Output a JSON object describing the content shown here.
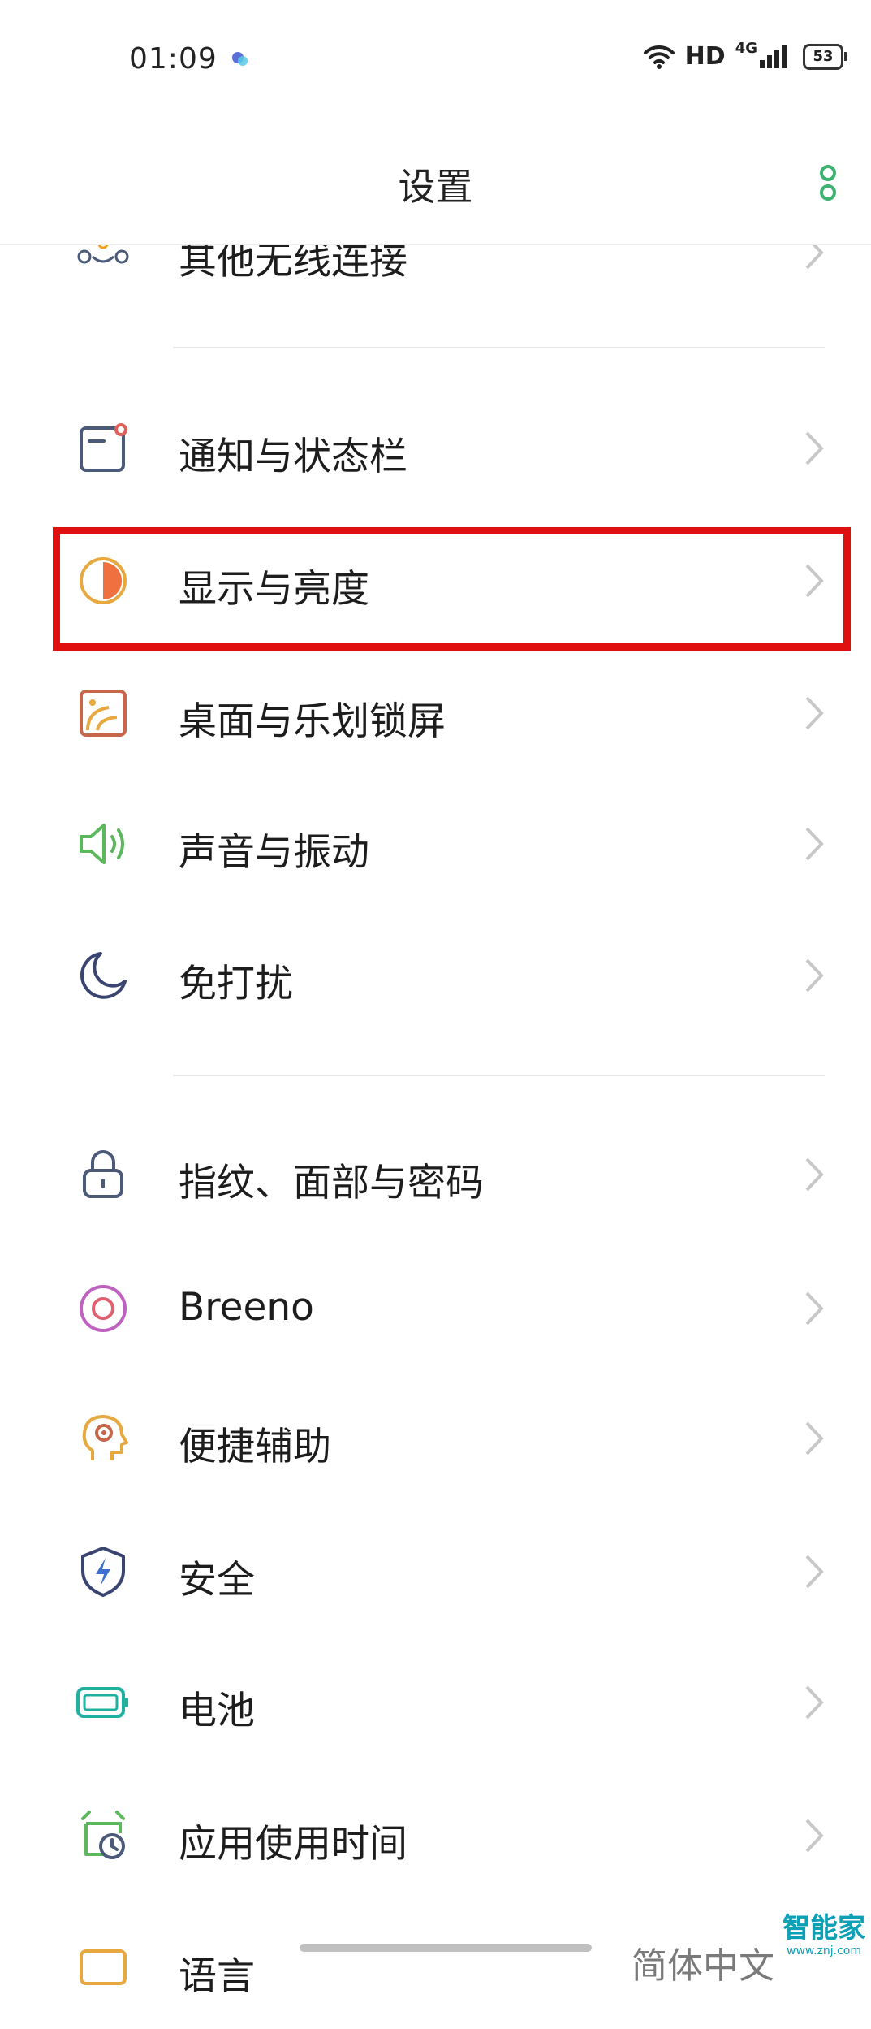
{
  "status_bar": {
    "time": "01:09",
    "network_label": "HD",
    "network_type": "4G",
    "battery_level": "53"
  },
  "header": {
    "title": "设置"
  },
  "settings_items": [
    {
      "id": "other-wireless",
      "label": "其他无线连接",
      "icon": "devices-link-icon"
    },
    {
      "id": "notifications",
      "label": "通知与状态栏",
      "icon": "notification-icon"
    },
    {
      "id": "display-brightness",
      "label": "显示与亮度",
      "icon": "brightness-icon"
    },
    {
      "id": "home-lockscreen",
      "label": "桌面与乐划锁屏",
      "icon": "wallpaper-icon"
    },
    {
      "id": "sound-vibration",
      "label": "声音与振动",
      "icon": "speaker-icon"
    },
    {
      "id": "do-not-disturb",
      "label": "免打扰",
      "icon": "moon-icon"
    },
    {
      "id": "fingerprint-face-password",
      "label": "指纹、面部与密码",
      "icon": "lock-icon"
    },
    {
      "id": "breeno",
      "label": "Breeno",
      "icon": "breeno-icon"
    },
    {
      "id": "accessibility",
      "label": "便捷辅助",
      "icon": "head-profile-icon"
    },
    {
      "id": "security",
      "label": "安全",
      "icon": "shield-icon"
    },
    {
      "id": "battery",
      "label": "电池",
      "icon": "battery-icon"
    },
    {
      "id": "screen-time",
      "label": "应用使用时间",
      "icon": "alarm-clock-icon"
    },
    {
      "id": "language",
      "label": "语言",
      "icon": "language-icon"
    }
  ],
  "partial_text": "简体中文",
  "watermark": {
    "main": "智能家",
    "sub": "www.znj.com"
  },
  "colors": {
    "highlight": "#e01010",
    "chevron": "#c8c8c8",
    "accent_green": "#3cb371"
  }
}
